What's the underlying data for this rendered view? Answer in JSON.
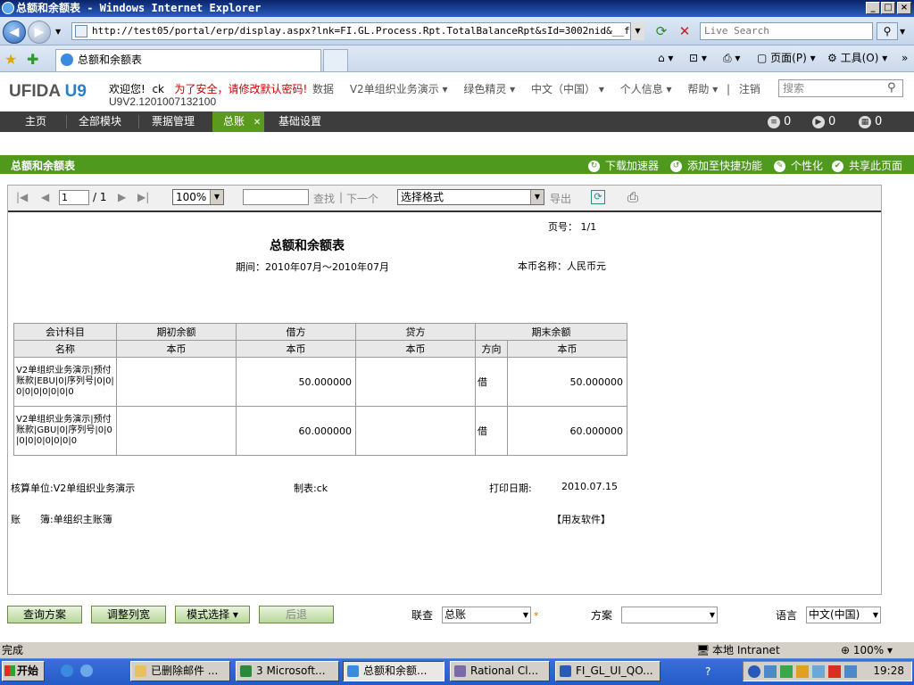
{
  "window": {
    "title": "总额和余额表 - Windows Internet Explorer"
  },
  "browser": {
    "url": "http://test05/portal/erp/display.aspx?lnk=FI.GL.Process.Rpt.TotalBalanceRpt&sId=3002nid&__fsk=",
    "badge": "360",
    "search_placeholder": "Live Search",
    "tab_title": "总额和余额表",
    "page_menu": "页面(P)",
    "tools_menu": "工具(O)"
  },
  "header": {
    "logo_text": "UFIDA",
    "logo_u9": "U9",
    "welcome": "欢迎您!",
    "user": "ck",
    "warning": "为了安全，请修改默认密码!",
    "version": "U9V2.1201007132100",
    "menu": [
      "数据",
      "V2单组织业务演示 ▾",
      "绿色精灵 ▾",
      "中文（中国） ▾",
      "个人信息 ▾",
      "帮助 ▾",
      "|",
      "注销"
    ],
    "search_placeholder": "搜索"
  },
  "nav": {
    "items": [
      "主页",
      "全部模块",
      "票据管理",
      "总账",
      "基础设置"
    ],
    "counters": [
      "0",
      "0",
      "0"
    ]
  },
  "section": {
    "title": "总额和余额表",
    "actions": [
      "下载加速器",
      "添加至快捷功能",
      "个性化",
      "共享此页面"
    ]
  },
  "report_toolbar": {
    "page_value": "1",
    "page_total": "/ 1",
    "zoom": "100%",
    "find": "查找",
    "sep": "|",
    "next": "下一个",
    "format": "选择格式",
    "export": "导出"
  },
  "report": {
    "page_no": "页号： 1/1",
    "title": "总额和余额表",
    "period": "期间：2010年07月～2010年07月",
    "currency": "本币名称：人民币元",
    "header1": [
      "会计科目",
      "期初余额",
      "借方",
      "贷方",
      "期末余额"
    ],
    "header2": [
      "名称",
      "本币",
      "本币",
      "本币",
      "方向",
      "本币"
    ],
    "rows": [
      {
        "name": "V2单组织业务演示|预付账款|EBU|0|序列号|0|0|0|0|0|0|0|0|0",
        "opening": "",
        "debit": "50.000000",
        "credit": "",
        "direction": "借",
        "closing": "50.000000"
      },
      {
        "name": "V2单组织业务演示|预付账款|GBU|0|序列号|0|0|0|0|0|0|0|0|0",
        "opening": "",
        "debit": "60.000000",
        "credit": "",
        "direction": "借",
        "closing": "60.000000"
      }
    ],
    "unit": "核算单位:V2单组织业务演示",
    "maker": "制表:ck",
    "print_label": "打印日期:",
    "print_date": "2010.07.15",
    "ledger": "账　　簿:单组织主账簿",
    "company": "【用友软件】"
  },
  "bottom": {
    "buttons": [
      "查询方案",
      "调整列宽",
      "模式选择 ▾",
      "后退"
    ],
    "link_label": "联查",
    "link_value": "总账",
    "scheme_label": "方案",
    "scheme_value": "",
    "lang_label": "语言",
    "lang_value": "中文(中国)"
  },
  "status": {
    "text": "完成",
    "zone": "本地 Intranet",
    "zoom": "100%"
  },
  "taskbar": {
    "start": "开始",
    "tasks": [
      "已删除邮件 ...",
      "3 Microsoft...",
      "总额和余额...",
      "Rational Cl...",
      "FI_GL_UI_QO..."
    ],
    "time": "19:28"
  }
}
